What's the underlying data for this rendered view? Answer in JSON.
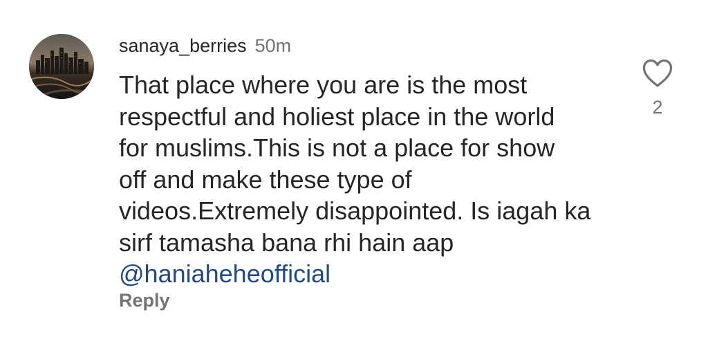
{
  "comment": {
    "username": "sanaya_berries",
    "time_ago": "50m",
    "text": "That place where you are is the most\nrespectful and holiest place in the world\nfor muslims.This is not a place for show\noff and make these type of\nvideos.Extremely disappointed. Is iagah ka\nsirf tamasha bana rhi hain aap",
    "mention": "@haniaheheofficial",
    "reply_label": "Reply",
    "like_count": "2",
    "avatar_icon": "city-skyline-avatar",
    "like_icon": "heart-outline-icon"
  },
  "colors": {
    "text": "#262626",
    "secondary": "#737373",
    "mention": "#1f4b85"
  }
}
